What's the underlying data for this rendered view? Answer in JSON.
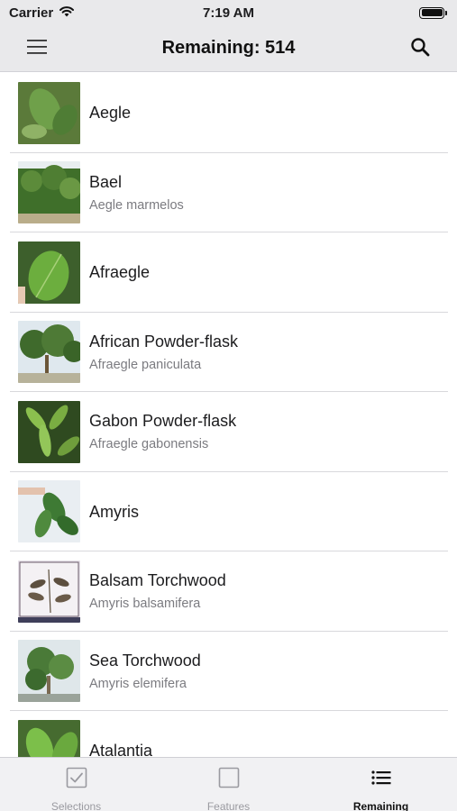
{
  "status_bar": {
    "carrier": "Carrier",
    "time": "7:19 AM"
  },
  "nav": {
    "title": "Remaining: 514",
    "menu_icon": "hamburger-menu-icon",
    "search_icon": "search-icon"
  },
  "list": {
    "items": [
      {
        "title": "Aegle",
        "subtitle": ""
      },
      {
        "title": "Bael",
        "subtitle": "Aegle marmelos"
      },
      {
        "title": "Afraegle",
        "subtitle": ""
      },
      {
        "title": "African Powder-flask",
        "subtitle": "Afraegle paniculata"
      },
      {
        "title": "Gabon Powder-flask",
        "subtitle": "Afraegle gabonensis"
      },
      {
        "title": "Amyris",
        "subtitle": ""
      },
      {
        "title": "Balsam Torchwood",
        "subtitle": "Amyris balsamifera"
      },
      {
        "title": "Sea Torchwood",
        "subtitle": "Amyris elemifera"
      },
      {
        "title": "Atalantia",
        "subtitle": ""
      }
    ]
  },
  "tabs": [
    {
      "label": "Selections",
      "icon": "checkbox-checked-icon",
      "active": false
    },
    {
      "label": "Features",
      "icon": "checkbox-empty-icon",
      "active": false
    },
    {
      "label": "Remaining",
      "icon": "list-icon",
      "active": true
    }
  ],
  "colors": {
    "bar_background": "#e9e9eb",
    "tab_inactive": "#9a9aa0",
    "tab_active": "#111111"
  }
}
